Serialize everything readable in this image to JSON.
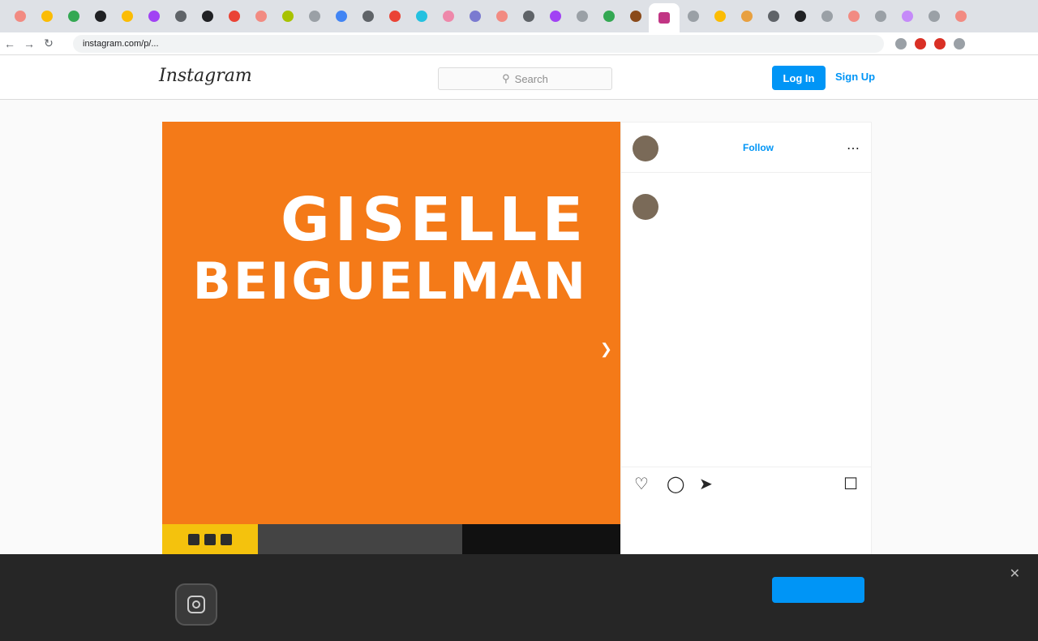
{
  "browser": {
    "tab_colors": [
      "#f28b82",
      "#fbbc04",
      "#34a853",
      "#202124",
      "#fbbc04",
      "#a142f4",
      "#5f6368",
      "#202124",
      "#ea4335",
      "#f28b82",
      "#a8c200",
      "#9aa0a6",
      "#4285f4",
      "#5f6368",
      "#ea4335",
      "#24c1e0",
      "#e8a",
      "#7a7ad0",
      "#f28b82",
      "#5f6368",
      "#a142f4",
      "#9aa0a6",
      "#34a853",
      "#8a4a1a"
    ],
    "tab_colors_right": [
      "#9aa0a6",
      "#fbbc04",
      "#e8a040",
      "#5f6368",
      "#202124",
      "#9aa0a6",
      "#f28b82",
      "#9aa0a6",
      "#c58af9",
      "#9aa0a6",
      "#f28b82"
    ],
    "url": "instagram.com/p/..."
  },
  "header": {
    "logo": "Instagram",
    "search_placeholder": "Search",
    "login_label": "Log In",
    "signup_label": "Sign Up"
  },
  "post": {
    "poster_line1": "GISELLE",
    "poster_line2": "BEIGUELMAN",
    "poster_small": "",
    "video_label": "",
    "author": "",
    "follow_label": "Follow",
    "more_icon": "more-icon",
    "caption_user": "",
    "caption_text": "",
    "caption_time": "",
    "comment_text": "",
    "likes_text": ""
  },
  "banner": {
    "title": "",
    "text": "",
    "accept_label": "",
    "learn_label": ""
  }
}
